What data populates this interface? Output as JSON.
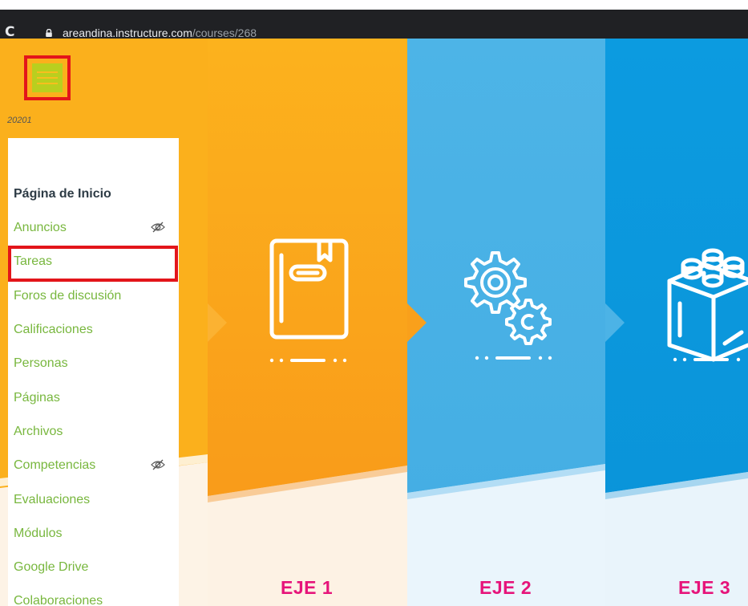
{
  "browser": {
    "domain": "areandina.instructure.com",
    "path": "/courses/268",
    "icons": {
      "reload": "reload-icon",
      "lock": "lock-icon"
    }
  },
  "course": {
    "term": "20201",
    "menu_icon": "hamburger-menu-icon"
  },
  "nav": {
    "items": [
      {
        "label": "Página de Inicio",
        "active": true,
        "hidden": false
      },
      {
        "label": "Anuncios",
        "active": false,
        "hidden": true
      },
      {
        "label": "Tareas",
        "active": false,
        "hidden": false,
        "highlighted": true
      },
      {
        "label": "Foros de discusión",
        "active": false,
        "hidden": false
      },
      {
        "label": "Calificaciones",
        "active": false,
        "hidden": false
      },
      {
        "label": "Personas",
        "active": false,
        "hidden": false
      },
      {
        "label": "Páginas",
        "active": false,
        "hidden": false
      },
      {
        "label": "Archivos",
        "active": false,
        "hidden": false
      },
      {
        "label": "Competencias",
        "active": false,
        "hidden": true
      },
      {
        "label": "Evaluaciones",
        "active": false,
        "hidden": false
      },
      {
        "label": "Módulos",
        "active": false,
        "hidden": false
      },
      {
        "label": "Google Drive",
        "active": false,
        "hidden": false
      },
      {
        "label": "Colaboraciones",
        "active": false,
        "hidden": false
      }
    ],
    "hidden_icon": "eye-slash-icon"
  },
  "axes": [
    {
      "label": "EJE 1",
      "icon": "book-icon"
    },
    {
      "label": "EJE 2",
      "icon": "gears-icon"
    },
    {
      "label": "EJE 3",
      "icon": "blocks-icon"
    }
  ],
  "colors": {
    "orange": "#f9a01b",
    "light_blue": "#4cb3e6",
    "blue": "#0a9ae0",
    "nav_link": "#78b73e",
    "axis_label": "#e6147a",
    "highlight": "#e3151a"
  }
}
